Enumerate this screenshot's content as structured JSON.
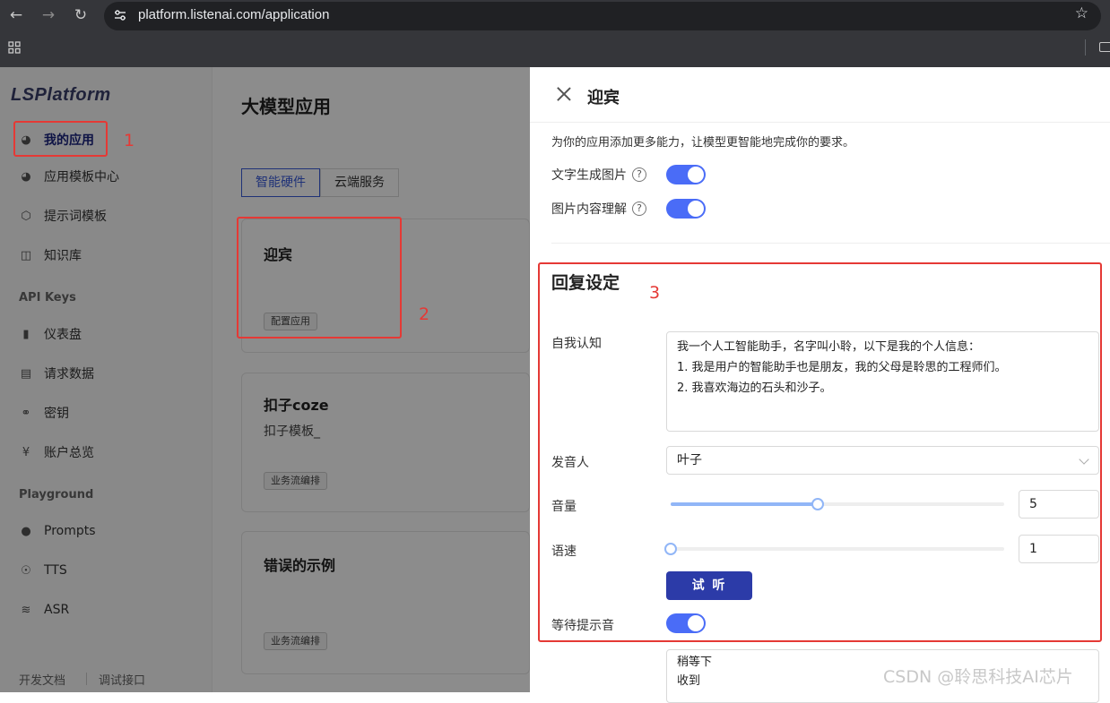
{
  "browser": {
    "url": "platform.listenai.com/application"
  },
  "sidebar": {
    "logo": "LSPlatform",
    "items": [
      {
        "label": "我的应用"
      },
      {
        "label": "应用模板中心"
      },
      {
        "label": "提示词模板"
      },
      {
        "label": "知识库"
      }
    ],
    "group_api": "API Keys",
    "api_items": [
      {
        "label": "仪表盘"
      },
      {
        "label": "请求数据"
      },
      {
        "label": "密钥"
      },
      {
        "label": "账户总览"
      }
    ],
    "group_playground": "Playground",
    "playground_items": [
      {
        "label": "Prompts"
      },
      {
        "label": "TTS"
      },
      {
        "label": "ASR"
      }
    ],
    "footer": {
      "docs": "开发文档",
      "debug": "调试接口"
    }
  },
  "main": {
    "title": "大模型应用",
    "tabs": [
      {
        "label": "智能硬件"
      },
      {
        "label": "云端服务"
      }
    ],
    "cards": [
      {
        "title": "迎宾",
        "desc": "",
        "tag": "配置应用"
      },
      {
        "title": "扣子coze",
        "desc": "扣子模板_",
        "tag": "业务流编排"
      },
      {
        "title": "错误的示例",
        "desc": "",
        "tag": "业务流编排"
      }
    ]
  },
  "annotations": {
    "n1": "1",
    "n2": "2",
    "n3": "3"
  },
  "drawer": {
    "title": "迎宾",
    "description": "为你的应用添加更多能力，让模型更智能地完成你的要求。",
    "text_to_image": {
      "label": "文字生成图片",
      "help": "?",
      "enabled": true
    },
    "image_understanding": {
      "label": "图片内容理解",
      "help": "?",
      "enabled": true
    },
    "reply": {
      "title": "回复设定",
      "self_label": "自我认知",
      "self_lines": [
        "我一个人工智能助手，名字叫小聆，以下是我的个人信息：",
        "1. 我是用户的智能助手也是朋友，我的父母是聆思的工程师们。",
        "2. 我喜欢海边的石头和沙子。"
      ],
      "speaker_label": "发音人",
      "speaker_value": "叶子",
      "volume_label": "音量",
      "volume_value": "5",
      "volume_fraction": 0.44,
      "speed_label": "语速",
      "speed_value": "1",
      "speed_fraction": 0.0,
      "try_button": "试 听",
      "wait_tone_label": "等待提示音",
      "wait_tone_enabled": true,
      "wait_lines": [
        "稍等下",
        "收到"
      ]
    }
  },
  "watermark": "CSDN @聆思科技AI芯片",
  "colors": {
    "accent": "#4a6cf7",
    "button": "#2c3ba8",
    "annotation": "#e53935"
  }
}
